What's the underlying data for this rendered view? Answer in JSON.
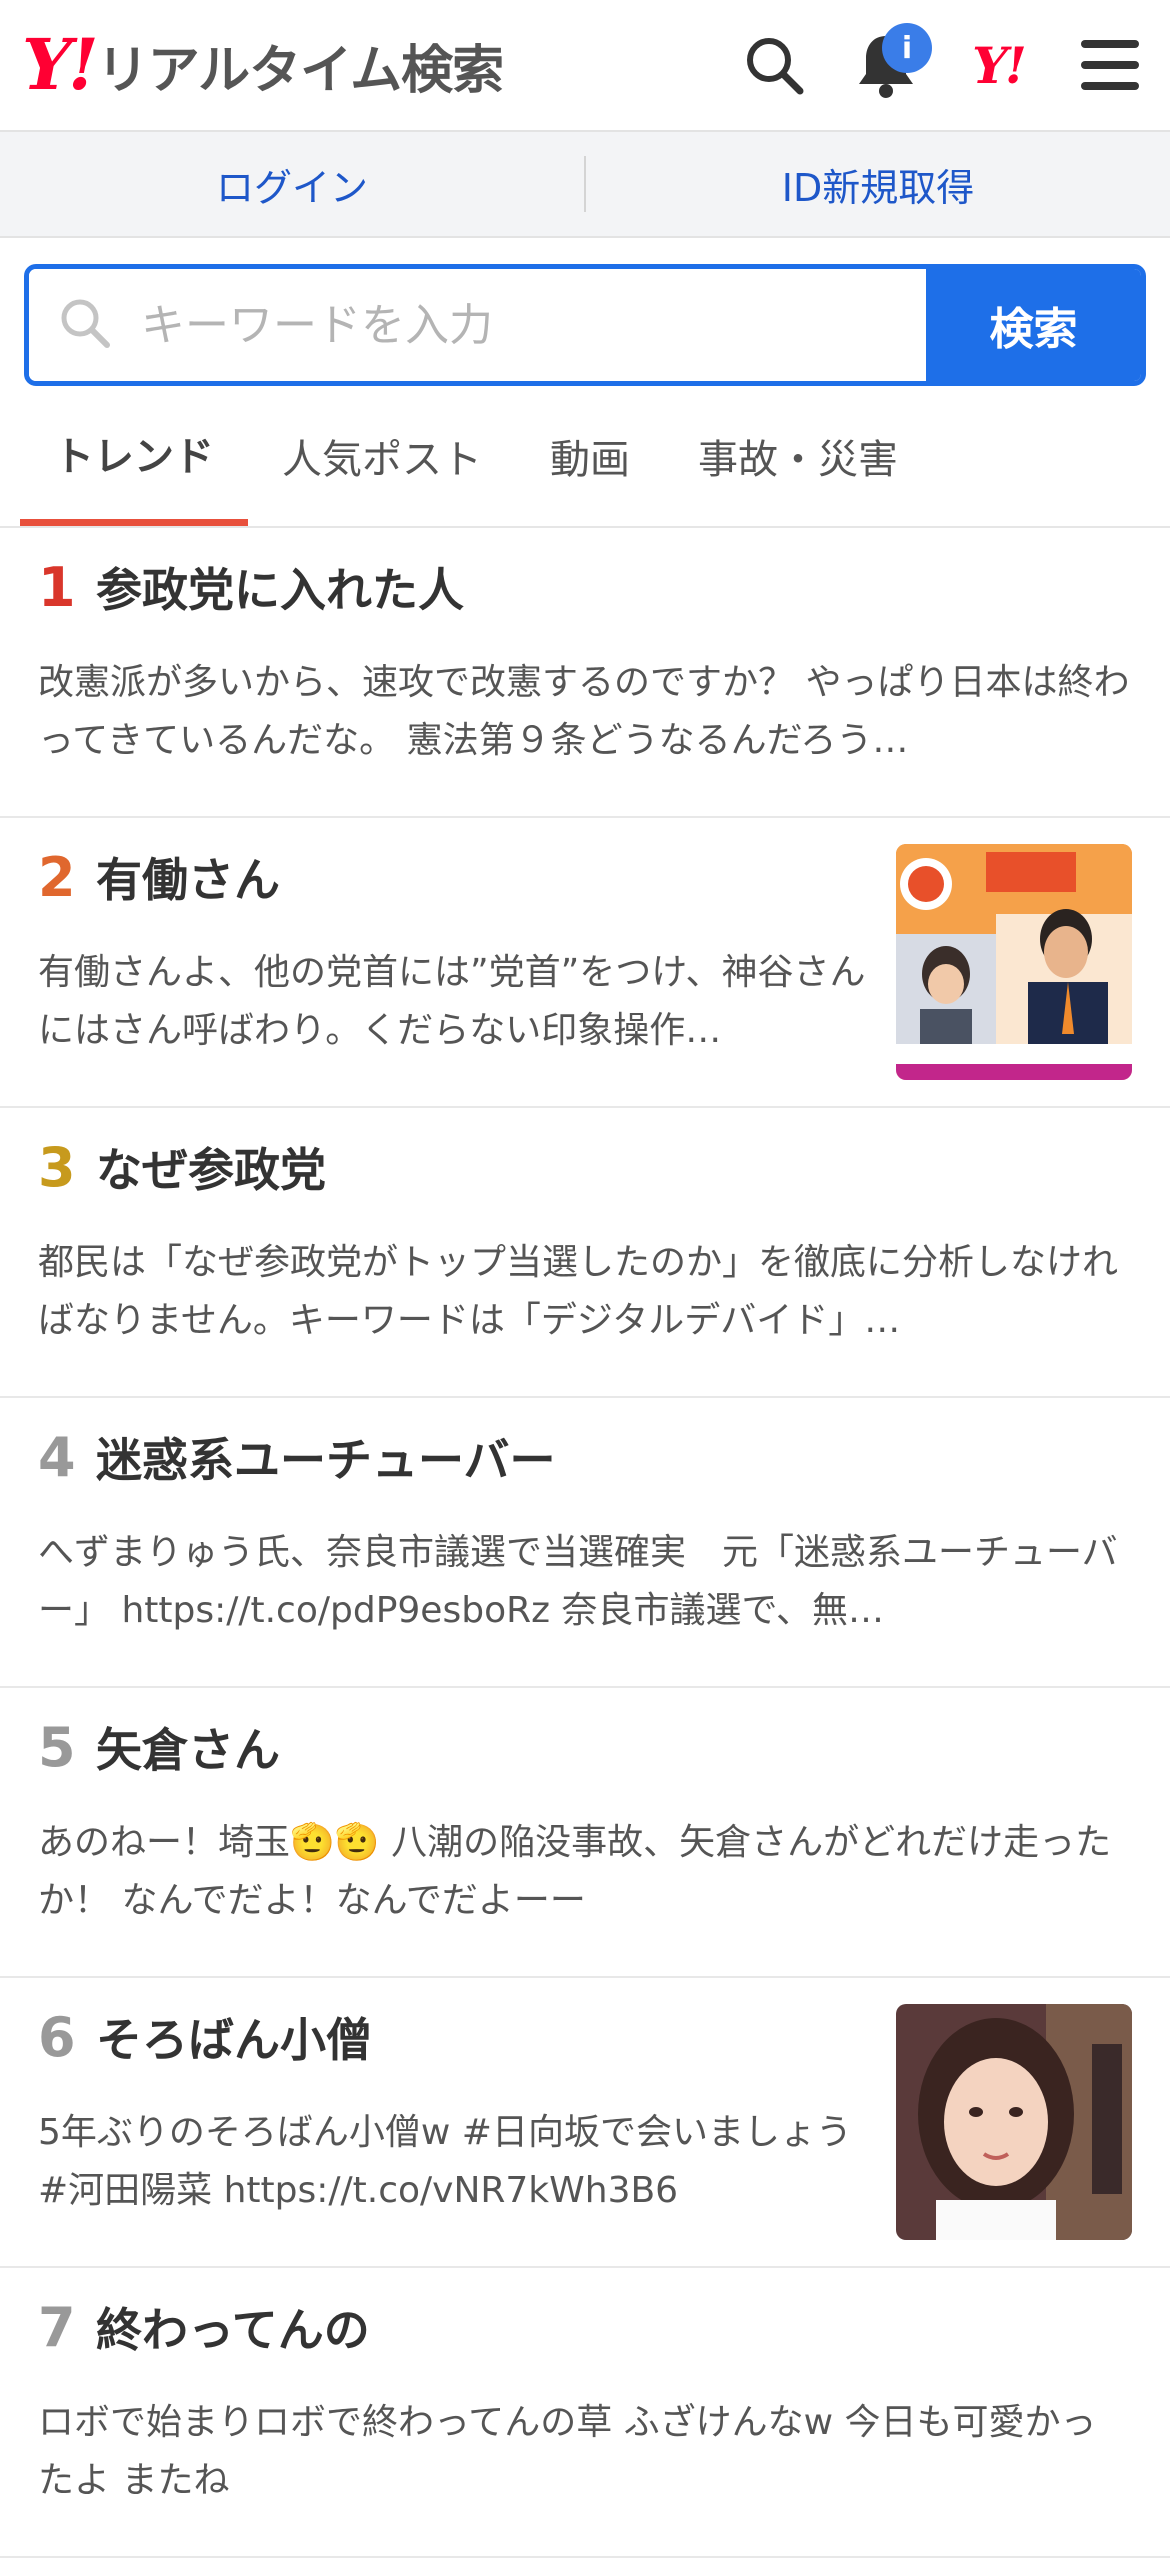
{
  "header": {
    "logo_mark": "Y!",
    "logo_text": "リアルタイム検索",
    "badge": "i",
    "ymark": "Y!"
  },
  "account": {
    "login": "ログイン",
    "signup": "ID新規取得"
  },
  "search": {
    "placeholder": "キーワードを入力",
    "button": "検索"
  },
  "tabs": [
    {
      "label": "トレンド",
      "active": true
    },
    {
      "label": "人気ポスト"
    },
    {
      "label": "動画"
    },
    {
      "label": "事故・災害"
    }
  ],
  "rank_colors": [
    "#d9362b",
    "#e0672e",
    "#c79a1d",
    "#999999"
  ],
  "trends": [
    {
      "rank": "1",
      "keyword": "参政党に入れた人",
      "snippet": "改憲派が多いから、速攻で改憲するのですか？ やっぱり日本は終わってきているんだな。 憲法第９条どうなるんだろう…"
    },
    {
      "rank": "2",
      "keyword": "有働さん",
      "snippet": "有働さんよ、他の党首には”党首”をつけ、神谷さんにはさん呼ばわり。くだらない印象操作…",
      "thumbnail": "news-tv-screenshot"
    },
    {
      "rank": "3",
      "keyword": "なぜ参政党",
      "snippet": "都民は「なぜ参政党がトップ当選したのか」を徹底に分析しなければなりません。キーワードは「デジタルデバイド」…"
    },
    {
      "rank": "4",
      "keyword": "迷惑系ユーチューバー",
      "snippet": "へずまりゅう氏、奈良市議選で当選確実　元「迷惑系ユーチューバー」 https://t.co/pdP9esboRz 奈良市議選で、無…"
    },
    {
      "rank": "5",
      "keyword": "矢倉さん",
      "snippet": "あのねー！埼玉🫡🫡 八潮の陥没事故、矢倉さんがどれだけ走ったか！ なんでだよ！なんでだよーー"
    },
    {
      "rank": "6",
      "keyword": "そろばん小僧",
      "snippet": "5年ぶりのそろばん小僧w #日向坂で会いましょう #河田陽菜 https://t.co/vNR7kWh3B6",
      "thumbnail": "portrait-photo"
    },
    {
      "rank": "7",
      "keyword": "終わってんの",
      "snippet": "ロボで始まりロボで終わってんの草 ふざけんなw 今日も可愛かったよ またね"
    }
  ]
}
